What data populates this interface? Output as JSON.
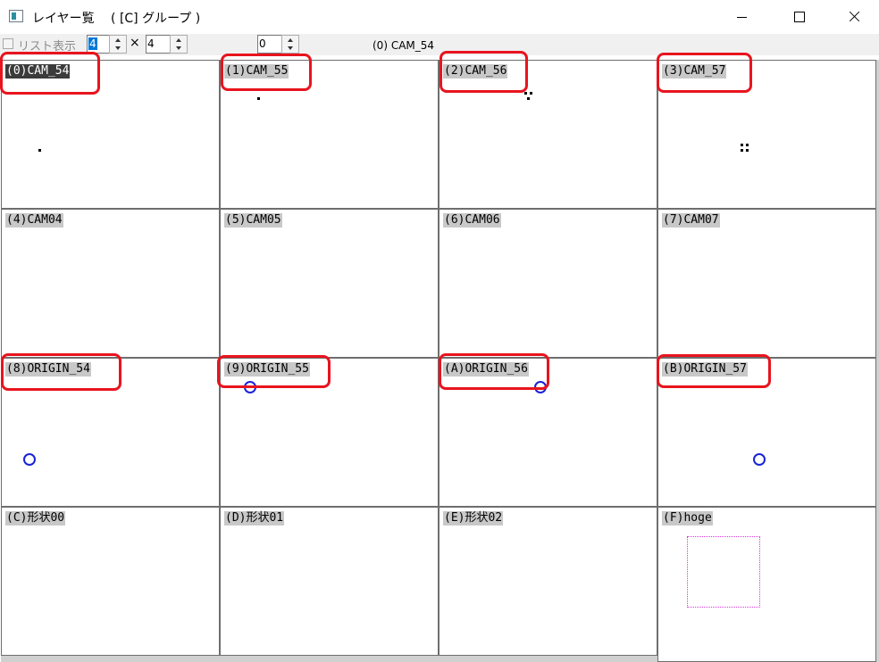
{
  "window": {
    "title": "レイヤー覧　 ( [C] グループ )"
  },
  "toolbar": {
    "list_view_label": "リスト表示",
    "list_view_checked": false,
    "columns_value": "4",
    "times_symbol": "×",
    "rows_value": "4",
    "layer_index_value": "0",
    "current_layer_text": "(0) CAM_54"
  },
  "layers": [
    {
      "label": "(0)CAM_54",
      "selected": true,
      "highlighted": true
    },
    {
      "label": "(1)CAM_55",
      "selected": false,
      "highlighted": true
    },
    {
      "label": "(2)CAM_56",
      "selected": false,
      "highlighted": true
    },
    {
      "label": "(3)CAM_57",
      "selected": false,
      "highlighted": true
    },
    {
      "label": "(4)CAM04",
      "selected": false,
      "highlighted": false
    },
    {
      "label": "(5)CAM05",
      "selected": false,
      "highlighted": false
    },
    {
      "label": "(6)CAM06",
      "selected": false,
      "highlighted": false
    },
    {
      "label": "(7)CAM07",
      "selected": false,
      "highlighted": false
    },
    {
      "label": "(8)ORIGIN_54",
      "selected": false,
      "highlighted": true
    },
    {
      "label": "(9)ORIGIN_55",
      "selected": false,
      "highlighted": true
    },
    {
      "label": "(A)ORIGIN_56",
      "selected": false,
      "highlighted": true
    },
    {
      "label": "(B)ORIGIN_57",
      "selected": false,
      "highlighted": true
    },
    {
      "label": "(C)形状00",
      "selected": false,
      "highlighted": false
    },
    {
      "label": "(D)形状01",
      "selected": false,
      "highlighted": false
    },
    {
      "label": "(E)形状02",
      "selected": false,
      "highlighted": false
    },
    {
      "label": "(F)hoge",
      "selected": false,
      "highlighted": false
    }
  ],
  "colors": {
    "highlight": "#e8141e",
    "origin_circle": "#1a23d6",
    "shape_outline": "#d836d8",
    "label_bg": "#c8c8c8",
    "selected_label_bg": "#3b3b3b"
  }
}
